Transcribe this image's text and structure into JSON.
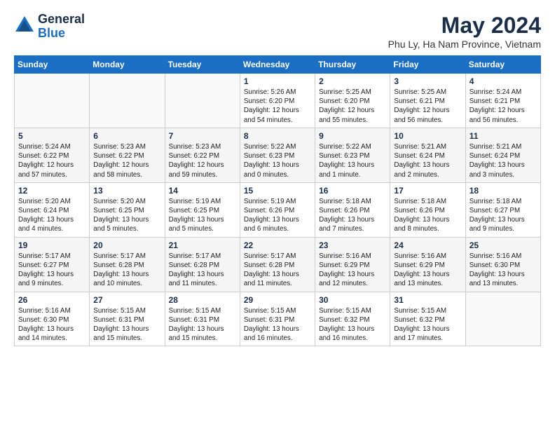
{
  "header": {
    "logo_general": "General",
    "logo_blue": "Blue",
    "title": "May 2024",
    "location": "Phu Ly, Ha Nam Province, Vietnam"
  },
  "weekdays": [
    "Sunday",
    "Monday",
    "Tuesday",
    "Wednesday",
    "Thursday",
    "Friday",
    "Saturday"
  ],
  "weeks": [
    [
      {
        "day": "",
        "info": ""
      },
      {
        "day": "",
        "info": ""
      },
      {
        "day": "",
        "info": ""
      },
      {
        "day": "1",
        "info": "Sunrise: 5:26 AM\nSunset: 6:20 PM\nDaylight: 12 hours\nand 54 minutes."
      },
      {
        "day": "2",
        "info": "Sunrise: 5:25 AM\nSunset: 6:20 PM\nDaylight: 12 hours\nand 55 minutes."
      },
      {
        "day": "3",
        "info": "Sunrise: 5:25 AM\nSunset: 6:21 PM\nDaylight: 12 hours\nand 56 minutes."
      },
      {
        "day": "4",
        "info": "Sunrise: 5:24 AM\nSunset: 6:21 PM\nDaylight: 12 hours\nand 56 minutes."
      }
    ],
    [
      {
        "day": "5",
        "info": "Sunrise: 5:24 AM\nSunset: 6:22 PM\nDaylight: 12 hours\nand 57 minutes."
      },
      {
        "day": "6",
        "info": "Sunrise: 5:23 AM\nSunset: 6:22 PM\nDaylight: 12 hours\nand 58 minutes."
      },
      {
        "day": "7",
        "info": "Sunrise: 5:23 AM\nSunset: 6:22 PM\nDaylight: 12 hours\nand 59 minutes."
      },
      {
        "day": "8",
        "info": "Sunrise: 5:22 AM\nSunset: 6:23 PM\nDaylight: 13 hours\nand 0 minutes."
      },
      {
        "day": "9",
        "info": "Sunrise: 5:22 AM\nSunset: 6:23 PM\nDaylight: 13 hours\nand 1 minute."
      },
      {
        "day": "10",
        "info": "Sunrise: 5:21 AM\nSunset: 6:24 PM\nDaylight: 13 hours\nand 2 minutes."
      },
      {
        "day": "11",
        "info": "Sunrise: 5:21 AM\nSunset: 6:24 PM\nDaylight: 13 hours\nand 3 minutes."
      }
    ],
    [
      {
        "day": "12",
        "info": "Sunrise: 5:20 AM\nSunset: 6:24 PM\nDaylight: 13 hours\nand 4 minutes."
      },
      {
        "day": "13",
        "info": "Sunrise: 5:20 AM\nSunset: 6:25 PM\nDaylight: 13 hours\nand 5 minutes."
      },
      {
        "day": "14",
        "info": "Sunrise: 5:19 AM\nSunset: 6:25 PM\nDaylight: 13 hours\nand 5 minutes."
      },
      {
        "day": "15",
        "info": "Sunrise: 5:19 AM\nSunset: 6:26 PM\nDaylight: 13 hours\nand 6 minutes."
      },
      {
        "day": "16",
        "info": "Sunrise: 5:18 AM\nSunset: 6:26 PM\nDaylight: 13 hours\nand 7 minutes."
      },
      {
        "day": "17",
        "info": "Sunrise: 5:18 AM\nSunset: 6:26 PM\nDaylight: 13 hours\nand 8 minutes."
      },
      {
        "day": "18",
        "info": "Sunrise: 5:18 AM\nSunset: 6:27 PM\nDaylight: 13 hours\nand 9 minutes."
      }
    ],
    [
      {
        "day": "19",
        "info": "Sunrise: 5:17 AM\nSunset: 6:27 PM\nDaylight: 13 hours\nand 9 minutes."
      },
      {
        "day": "20",
        "info": "Sunrise: 5:17 AM\nSunset: 6:28 PM\nDaylight: 13 hours\nand 10 minutes."
      },
      {
        "day": "21",
        "info": "Sunrise: 5:17 AM\nSunset: 6:28 PM\nDaylight: 13 hours\nand 11 minutes."
      },
      {
        "day": "22",
        "info": "Sunrise: 5:17 AM\nSunset: 6:28 PM\nDaylight: 13 hours\nand 11 minutes."
      },
      {
        "day": "23",
        "info": "Sunrise: 5:16 AM\nSunset: 6:29 PM\nDaylight: 13 hours\nand 12 minutes."
      },
      {
        "day": "24",
        "info": "Sunrise: 5:16 AM\nSunset: 6:29 PM\nDaylight: 13 hours\nand 13 minutes."
      },
      {
        "day": "25",
        "info": "Sunrise: 5:16 AM\nSunset: 6:30 PM\nDaylight: 13 hours\nand 13 minutes."
      }
    ],
    [
      {
        "day": "26",
        "info": "Sunrise: 5:16 AM\nSunset: 6:30 PM\nDaylight: 13 hours\nand 14 minutes."
      },
      {
        "day": "27",
        "info": "Sunrise: 5:15 AM\nSunset: 6:31 PM\nDaylight: 13 hours\nand 15 minutes."
      },
      {
        "day": "28",
        "info": "Sunrise: 5:15 AM\nSunset: 6:31 PM\nDaylight: 13 hours\nand 15 minutes."
      },
      {
        "day": "29",
        "info": "Sunrise: 5:15 AM\nSunset: 6:31 PM\nDaylight: 13 hours\nand 16 minutes."
      },
      {
        "day": "30",
        "info": "Sunrise: 5:15 AM\nSunset: 6:32 PM\nDaylight: 13 hours\nand 16 minutes."
      },
      {
        "day": "31",
        "info": "Sunrise: 5:15 AM\nSunset: 6:32 PM\nDaylight: 13 hours\nand 17 minutes."
      },
      {
        "day": "",
        "info": ""
      }
    ]
  ]
}
